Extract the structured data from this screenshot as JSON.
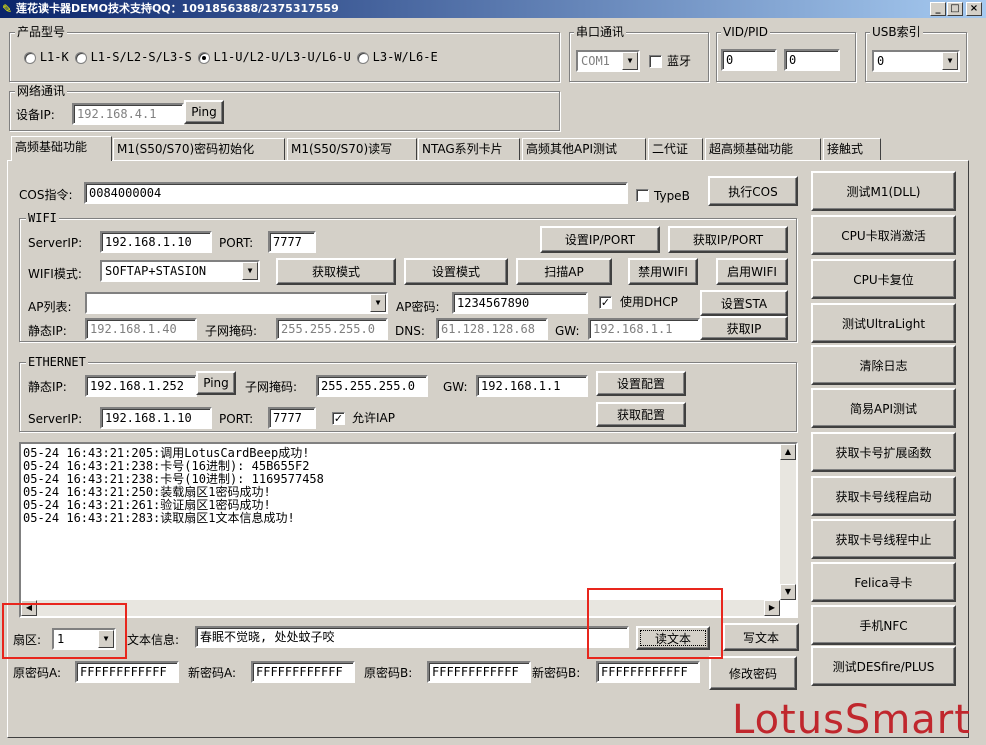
{
  "window": {
    "title": "莲花读卡器DEMO技术支持QQ：1091856388/2375317559",
    "icon": "app-icon"
  },
  "product_group": {
    "label": "产品型号",
    "options": [
      "L1-K",
      "L1-S/L2-S/L3-S",
      "L1-U/L2-U/L3-U/L6-U",
      "L3-W/L6-E"
    ],
    "selected_index": 2
  },
  "serial_group": {
    "label": "串口通讯",
    "port": "COM1",
    "bluetooth_label": "蓝牙",
    "bluetooth_checked": false
  },
  "vidpid_group": {
    "label": "VID/PID",
    "vid": "0",
    "pid": "0"
  },
  "usb_group": {
    "label": "USB索引",
    "value": "0"
  },
  "network_group": {
    "label": "网络通讯",
    "ip_label": "设备IP:",
    "ip": "192.168.4.1",
    "ping": "Ping"
  },
  "tabs": [
    "高频基础功能",
    "M1(S50/S70)密码初始化",
    "M1(S50/S70)读写",
    "NTAG系列卡片",
    "高频其他API测试",
    "二代证",
    "超高频基础功能",
    "接触式"
  ],
  "cos": {
    "label": "COS指令:",
    "value": "0084000004",
    "typeb_label": "TypeB",
    "typeb_checked": false,
    "exec": "执行COS"
  },
  "wifi": {
    "label": "WIFI",
    "server_ip_label": "ServerIP:",
    "server_ip": "192.168.1.10",
    "port_label": "PORT:",
    "port": "7777",
    "set_ip_port": "设置IP/PORT",
    "get_ip_port": "获取IP/PORT",
    "mode_label": "WIFI模式:",
    "mode": "SOFTAP+STASION",
    "get_mode": "获取模式",
    "set_mode": "设置模式",
    "scan_ap": "扫描AP",
    "disable_wifi": "禁用WIFI",
    "enable_wifi": "启用WIFI",
    "ap_list_label": "AP列表:",
    "ap_list": "",
    "ap_pwd_label": "AP密码:",
    "ap_pwd": "1234567890",
    "dhcp_label": "使用DHCP",
    "dhcp_checked": true,
    "set_sta": "设置STA",
    "static_ip_label": "静态IP:",
    "static_ip": "192.168.1.40",
    "mask_label": "子网掩码:",
    "mask": "255.255.255.0",
    "dns_label": "DNS:",
    "dns": "61.128.128.68",
    "gw_label": "GW:",
    "gw": "192.168.1.1",
    "get_ip": "获取IP"
  },
  "ethernet": {
    "label": "ETHERNET",
    "static_ip_label": "静态IP:",
    "static_ip": "192.168.1.252",
    "ping": "Ping",
    "mask_label": "子网掩码:",
    "mask": "255.255.255.0",
    "gw_label": "GW:",
    "gw": "192.168.1.1",
    "set_config": "设置配置",
    "get_config": "获取配置",
    "server_ip_label": "ServerIP:",
    "server_ip": "192.168.1.10",
    "port_label": "PORT:",
    "port": "7777",
    "iap_label": "允许IAP",
    "iap_checked": true
  },
  "log_lines": [
    "05-24 16:43:21:205:调用LotusCardBeep成功!",
    "05-24 16:43:21:238:卡号(16进制): 45B655F2",
    "05-24 16:43:21:238:卡号(10进制): 1169577458",
    "05-24 16:43:21:250:装载扇区1密码成功!",
    "05-24 16:43:21:261:验证扇区1密码成功!",
    "05-24 16:43:21:283:读取扇区1文本信息成功!"
  ],
  "sector": {
    "label": "扇区:",
    "value": "1"
  },
  "text_info": {
    "label": "文本信息:",
    "value": "春眠不觉晓, 处处蚊子咬"
  },
  "read_text": "读文本",
  "write_text": "写文本",
  "passwords": {
    "old_a_label": "原密码A:",
    "old_a": "FFFFFFFFFFFF",
    "new_a_label": "新密码A:",
    "new_a": "FFFFFFFFFFFF",
    "old_b_label": "原密码B:",
    "old_b": "FFFFFFFFFFFF",
    "new_b_label": "新密码B:",
    "new_b": "FFFFFFFFFFFF",
    "change": "修改密码"
  },
  "side_buttons": [
    "测试M1(DLL)",
    "CPU卡取消激活",
    "CPU卡复位",
    "测试UltraLight",
    "清除日志",
    "简易API测试",
    "获取卡号扩展函数",
    "获取卡号线程启动",
    "获取卡号线程中止",
    "Felica寻卡",
    "手机NFC",
    "测试DESfire/PLUS"
  ],
  "watermark": "LotusSmart",
  "highlight_color": "#e8261d"
}
